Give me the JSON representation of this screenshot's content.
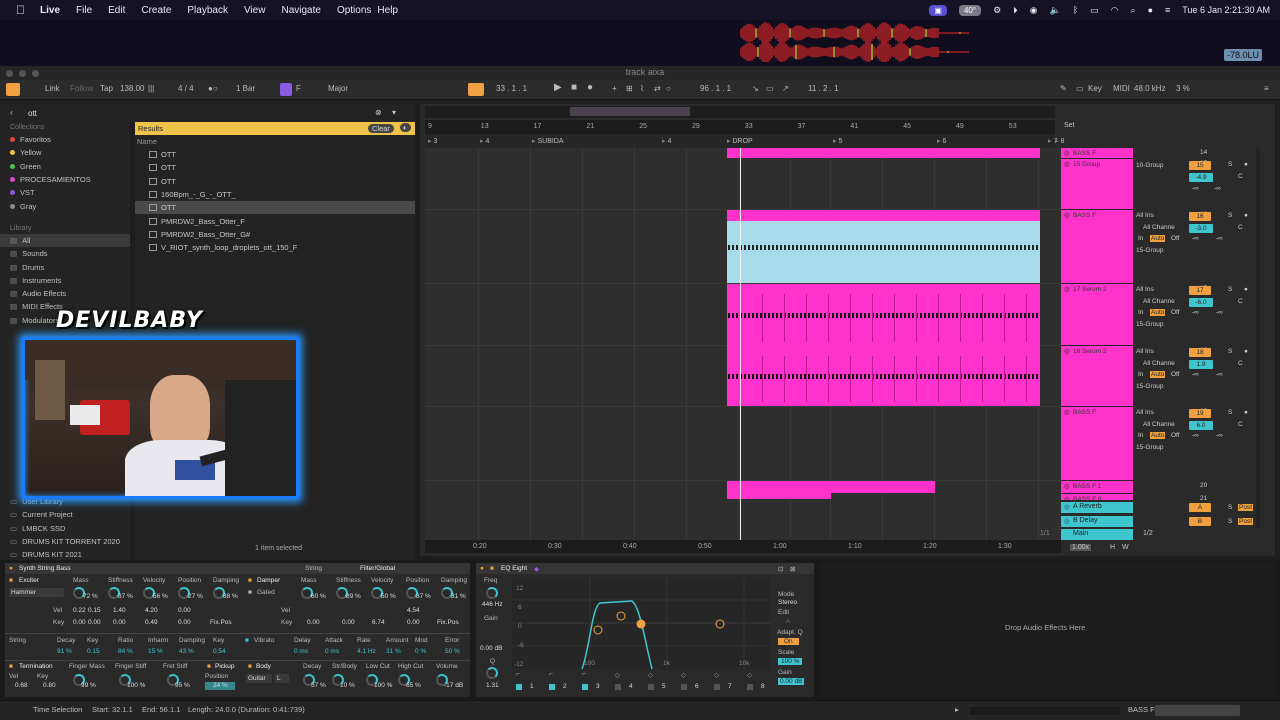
{
  "menubar": {
    "items": [
      "Live",
      "File",
      "Edit",
      "Create",
      "Playback",
      "View",
      "Navigate",
      "Options",
      "Help"
    ],
    "temperature": "40°",
    "clock": "Tue 6 Jan  2:21:30 AM"
  },
  "level_readout": "-78.0LU",
  "window_title": "track aixa",
  "transport": {
    "link": "Link",
    "follow": "Follow",
    "tap": "Tap",
    "tempo": "138.00",
    "signature": "4 / 4",
    "quantize": "1 Bar",
    "key": "F",
    "scale": "Major",
    "position": "33 .  1 .  1",
    "loop_start": "96 .  1 .  1",
    "loop_length": "11 .  2 .  1",
    "key_label": "Key",
    "midi_label": "MIDI",
    "sample_rate": "48.0 kHz",
    "cpu": "3 %"
  },
  "browser": {
    "search": "ott",
    "collections_header": "Collections",
    "collections": [
      {
        "label": "Favoritos",
        "color": "#e0433a"
      },
      {
        "label": "Yellow",
        "color": "#e8c83a"
      },
      {
        "label": "Green",
        "color": "#4ec24e"
      },
      {
        "label": "PROCESAMIENTOS",
        "color": "#e04ad0"
      },
      {
        "label": "VST",
        "color": "#8a5ae0"
      },
      {
        "label": "Gray",
        "color": "#8a8a8a"
      }
    ],
    "library_header": "Library",
    "library": [
      "All",
      "Sounds",
      "Drums",
      "Instruments",
      "Audio Effects",
      "MIDI Effects",
      "Modulators"
    ],
    "places": [
      "User Library",
      "Current Project",
      "LMBCK SSD",
      "DRUMS KIT TORRENT 2020",
      "DRUMS KIT 2021"
    ],
    "results_label": "Results",
    "clear_label": "Clear",
    "name_col": "Name",
    "results": [
      "OTT",
      "OTT",
      "OTT",
      "160Bpm_-_G_-_OTT_",
      "OTT",
      "PMRDW2_Bass_Otter_F",
      "PMRDW2_Bass_Otter_G#",
      "V_RIOT_synth_loop_droplets_ott_150_F"
    ],
    "selected_index": 4,
    "status": "1 item selected"
  },
  "overlay": {
    "streamer_name": "DEVILBABY"
  },
  "arrangement": {
    "bar_numbers": [
      "9",
      "13",
      "17",
      "21",
      "25",
      "29",
      "33",
      "37",
      "41",
      "45",
      "49",
      "53"
    ],
    "locators": [
      "3",
      "4",
      "SUBIDA",
      "4",
      "DROP",
      "5",
      "6",
      "7",
      "8"
    ],
    "set_label": "Set",
    "time_ticks": [
      "0:20",
      "0:30",
      "0:40",
      "0:50",
      "1:00",
      "1:10",
      "1:20",
      "1:30"
    ],
    "page": "1/1"
  },
  "tracks": [
    {
      "name": "BASS F",
      "num": "14",
      "color": "#ff33cc"
    },
    {
      "name": "15 Group",
      "num": "15",
      "routing": "10-Group",
      "vol": "-4.9",
      "color": "#ff33cc"
    },
    {
      "name": "BASS F",
      "num": "16",
      "input": "All Ins",
      "channel": "All Channe",
      "vol": "-3.0",
      "output": "15-Group",
      "color": "#ff33cc"
    },
    {
      "name": "17 Serum 2",
      "num": "17",
      "input": "All Ins",
      "channel": "All Channe",
      "vol": "-6.0",
      "output": "15-Group",
      "color": "#ff33cc"
    },
    {
      "name": "18 Serum 2",
      "num": "18",
      "input": "All Ins",
      "channel": "All Channe",
      "vol": "1.9",
      "output": "15-Group",
      "color": "#ff33cc"
    },
    {
      "name": "BASS F",
      "num": "19",
      "input": "All Ins",
      "channel": "All Channe",
      "vol": "6.0",
      "output": "15-Group",
      "color": "#ff33cc"
    },
    {
      "name": "BASS F 1",
      "num": "20",
      "color": "#ff33cc"
    },
    {
      "name": "BASS F 9",
      "num": "21",
      "color": "#ff33cc"
    }
  ],
  "mixer_labels": {
    "in": "In",
    "auto": "Auto",
    "off": "Off",
    "inf": "-∞",
    "c": "C",
    "s": "S",
    "post": "Post"
  },
  "returns": [
    {
      "name": "A Reverb",
      "letter": "A"
    },
    {
      "name": "B Delay",
      "letter": "B"
    }
  ],
  "main": {
    "name": "Main",
    "routing": "1/2",
    "zoom": "1.00x",
    "h": "H",
    "w": "W"
  },
  "synth": {
    "title": "Synth String Bass",
    "string_tab": "String",
    "filter_tab": "Filter/Global",
    "exciter": "Exciter",
    "exciter_type": "Hammer",
    "exc_params": [
      {
        "label": "Mass",
        "value": "72 %"
      },
      {
        "label": "Stiffness",
        "value": "37 %"
      },
      {
        "label": "Velocity",
        "value": "56 %"
      },
      {
        "label": "Position",
        "value": "27 %"
      },
      {
        "label": "Damping",
        "value": "38 %"
      }
    ],
    "vel_row": [
      "0.22",
      "0.15",
      "1.40",
      "4.20",
      "0.00"
    ],
    "key_row": [
      "0.00",
      "0.00",
      "0.00",
      "0.49",
      "0.00"
    ],
    "damper": "Damper",
    "gated": "Gated",
    "damp_params": [
      {
        "label": "Mass",
        "value": "60 %"
      },
      {
        "label": "Stiffness",
        "value": "89 %"
      },
      {
        "label": "Velocity",
        "value": "50 %"
      },
      {
        "label": "Position",
        "value": "37 %"
      },
      {
        "label": "Damping",
        "value": "31 %"
      }
    ],
    "damp_vel": "4.54",
    "damp_key_row": [
      "0.00",
      "0.00",
      "6.74",
      "0.00"
    ],
    "fixpos": "Fix.Pos",
    "string_labels": [
      "String",
      "Decay",
      "Key",
      "Ratio",
      "Inharm",
      "Damping",
      "Key"
    ],
    "string_values": [
      "91 %",
      "0.15",
      "84 %",
      "15 %",
      "43 %",
      "0.54"
    ],
    "vibrato": "Vibrato",
    "vib_labels": [
      "Delay",
      "Attack",
      "Rate",
      "Amount",
      "Mod",
      "Error"
    ],
    "vib_values": [
      "0 ms",
      "0 ms",
      "4.1 Hz",
      "31 %",
      "0 %",
      "50 %"
    ],
    "termination": "Termination",
    "term_labels": [
      "Finger Mass",
      "Finger Stiff",
      "Fret Stiff"
    ],
    "term_values": [
      "99 %",
      "100 %",
      "95 %"
    ],
    "vel_label": "Vel",
    "key_label": "Key",
    "term_vel": "0.68",
    "term_key": "0.80",
    "pickup": "Pickup",
    "pickup_pos": "Position",
    "pickup_val": "24 %",
    "body": "Body",
    "body_type": "Guitar",
    "body_l": "L",
    "body_labels": [
      "Decay",
      "Str/Body",
      "Low Cut",
      "High Cut",
      "Volume"
    ],
    "body_values": [
      "57 %",
      "10 %",
      "100 %",
      "65 %",
      "-17 dB"
    ]
  },
  "eq": {
    "title": "EQ Eight",
    "freq_label": "Freq",
    "freq_value": "446 Hz",
    "gain_label": "Gain",
    "gain_value": "0.00 dB",
    "q_label": "Q",
    "q_value": "1.31",
    "y_ticks": [
      "12",
      "6",
      "0",
      "-6",
      "-12"
    ],
    "x_ticks": [
      "100",
      "1k",
      "10k"
    ],
    "bands": [
      "1",
      "2",
      "3",
      "4",
      "5",
      "6",
      "7",
      "8"
    ],
    "mode_label": "Mode",
    "mode_value": "Stereo",
    "edit_label": "Edit",
    "edit_value": "A",
    "adapt_label": "Adapt. Q",
    "adapt_value": "On",
    "scale_label": "Scale",
    "scale_value": "100 %",
    "gain_out_label": "Gain",
    "gain_out_value": "0.00 dB"
  },
  "drop_text": "Drop Audio Effects Here",
  "status_bar": {
    "label": "Time Selection",
    "start": "Start: 32.1.1",
    "end": "End: 56.1.1",
    "length": "Length: 24.0.0 (Duration: 0:41:739)",
    "track": "BASS F"
  },
  "colors": {
    "accent_pink": "#ff33cc",
    "accent_orange": "#f0a040",
    "accent_teal": "#3ec5ce",
    "clip_blue": "#a8dcea",
    "results_yellow": "#f0c34a"
  }
}
